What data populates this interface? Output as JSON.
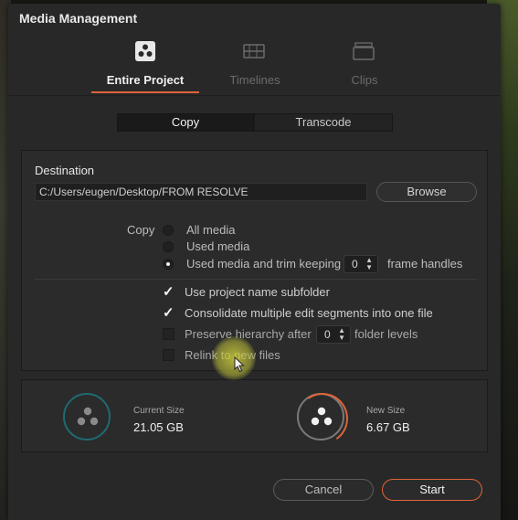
{
  "dialog": {
    "title": "Media Management"
  },
  "tabs": [
    {
      "label": "Entire Project",
      "icon": "resolve-logo-icon",
      "active": true
    },
    {
      "label": "Timelines",
      "icon": "timeline-icon",
      "active": false
    },
    {
      "label": "Clips",
      "icon": "clips-icon",
      "active": false
    }
  ],
  "mode": {
    "copy_label": "Copy",
    "transcode_label": "Transcode",
    "selected": "Copy"
  },
  "destination": {
    "label": "Destination",
    "path": "C:/Users/eugen/Desktop/FROM RESOLVE",
    "browse_label": "Browse"
  },
  "copy_options": {
    "label": "Copy",
    "all_media": "All media",
    "used_media": "Used media",
    "used_media_trim": "Used media and trim keeping",
    "frame_handles_value": "0",
    "frame_handles_suffix": "frame handles",
    "selected": "Used media and trim keeping"
  },
  "options": {
    "use_project_name_subfolder": {
      "label": "Use project name subfolder",
      "checked": true
    },
    "consolidate": {
      "label": "Consolidate multiple edit segments into one file",
      "checked": true
    },
    "preserve_hierarchy": {
      "label": "Preserve hierarchy after",
      "value": "0",
      "suffix": "folder levels",
      "checked": false
    },
    "relink": {
      "label": "Relink to new files",
      "checked": false
    }
  },
  "sizes": {
    "current_label": "Current Size",
    "current_value": "21.05 GB",
    "new_label": "New Size",
    "new_value": "6.67 GB"
  },
  "footer": {
    "cancel_label": "Cancel",
    "start_label": "Start"
  },
  "colors": {
    "accent": "#e0643a",
    "teal": "#1f6a72",
    "dialog_bg": "#282828"
  }
}
